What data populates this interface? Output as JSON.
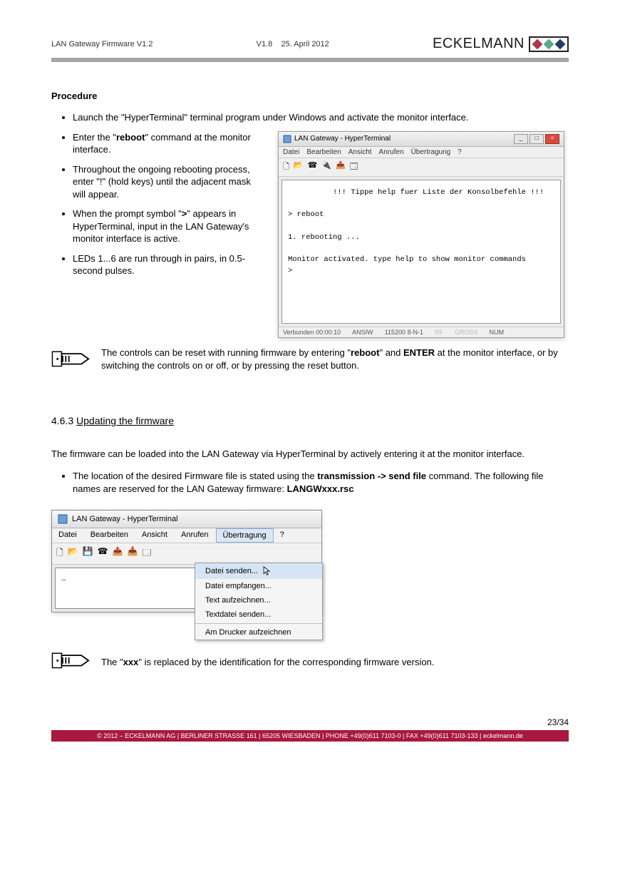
{
  "header": {
    "doc_title": "LAN Gateway Firmware V1.2",
    "version": "V1.8",
    "date": "25. April 2012",
    "brand": "ECKELMANN"
  },
  "procedure": {
    "heading": "Procedure",
    "items": [
      "Launch the \"HyperTerminal\"  terminal program under Windows and activate the monitor interface.",
      "Enter the \"",
      "\" command at the monitor interface.",
      "Throughout the ongoing rebooting process, enter \"!\" (hold keys) until the adjacent mask will appear.",
      "When the prompt symbol \"",
      "\" appears in HyperTerminal, input in the LAN Gateway's monitor interface is active.",
      "LEDs 1...6 are run through in pairs, in 0.5-second pulses."
    ],
    "reboot_bold": "reboot",
    "gt_bold": ">"
  },
  "ht1": {
    "title": "LAN Gateway - HyperTerminal",
    "menu": [
      "Datei",
      "Bearbeiten",
      "Ansicht",
      "Anrufen",
      "Übertragung",
      "?"
    ],
    "terminal_lines": "          !!! Tippe help fuer Liste der Konsolbefehle !!!\n\n> reboot\n\n1. rebooting ...\n\nMonitor activated. type help to show monitor commands\n>",
    "status": {
      "connected": "Verbunden 00:00:10",
      "ansi": "ANSIW",
      "baud": "115200 8-N-1",
      "num": "NUM"
    }
  },
  "note1": {
    "pre": "The controls can be reset with running firmware by entering \"",
    "mid": "\" and ",
    "post": " at the monitor interface, or by switching the controls on or off, or by pressing the reset button.",
    "reboot": "reboot",
    "enter": "ENTER"
  },
  "section463": {
    "num": "4.6.3",
    "title": "Updating the firmware",
    "intro": "The firmware can be loaded into the LAN Gateway via HyperTerminal by actively entering it at the monitor interface.",
    "bullet_pre": "The location of the desired Firmware file is stated using the ",
    "bullet_cmd": "transmission -> send file",
    "bullet_mid": " command. The following file names are reserved for the LAN Gateway firmware: ",
    "bullet_file": "LANGWxxx.rsc"
  },
  "ht2": {
    "title": "LAN Gateway - HyperTerminal",
    "menu": [
      "Datei",
      "Bearbeiten",
      "Ansicht",
      "Anrufen",
      "Übertragung",
      "?"
    ],
    "dropdown": [
      "Datei senden...",
      "Datei empfangen...",
      "Text aufzeichnen...",
      "Textdatei senden...",
      "Am Drucker aufzeichnen"
    ],
    "prompt": "_"
  },
  "note2": {
    "pre": "The \"",
    "xxx": "xxx",
    "post": "\" is replaced by the identification for the corresponding firmware version."
  },
  "pagenum": "23/34",
  "footer": "© 2012 – ECKELMANN AG | BERLINER STRASSE 161 | 65205 WIESBADEN | PHONE +49(0)611 7103-0 | FAX +49(0)611 7103-133 | eckelmann.de"
}
